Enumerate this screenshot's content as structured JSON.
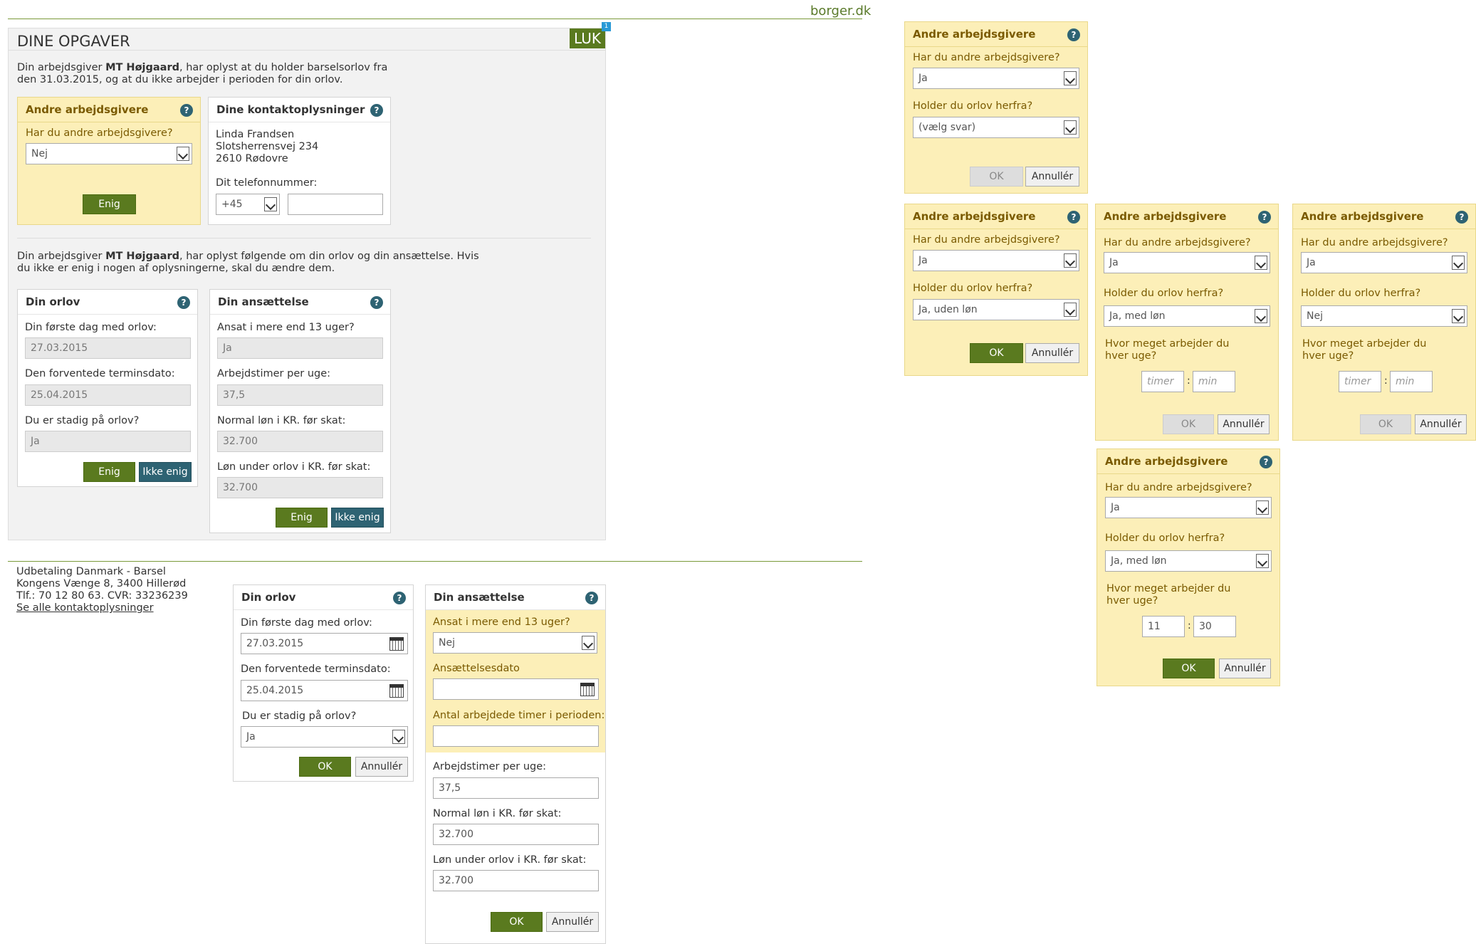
{
  "brand": "borger.dk",
  "main": {
    "title": "DINE OPGAVER",
    "close_label": "LUK",
    "badge": "1",
    "intro1_a": "Din arbejdsgiver ",
    "intro1_employer": "MT Højgaard",
    "intro1_b": ", har oplyst at du holder barselsorlov fra",
    "intro1_c": "den 31.03.2015, og at du ikke arbejder i perioden for din orlov.",
    "intro2_a": "Din arbejdsgiver ",
    "intro2_employer": "MT Højgaard",
    "intro2_b": ", har oplyst følgende om din orlov og din ansættelse. Hvis",
    "intro2_c": "du ikke er enig i nogen af oplysningerne, skal du ændre dem."
  },
  "help": "?",
  "other_employers": {
    "title": "Andre arbejdsgivere",
    "q1": "Har du andre arbejdsgivere?",
    "q2": "Holder du orlov herfra?",
    "q3": "Hvor meget arbejder du hver uge?",
    "value_no": "Nej",
    "value_yes": "Ja",
    "choose": "(vælg svar)",
    "leave_unpaid": "Ja, uden løn",
    "leave_paid": "Ja, med løn",
    "agree": "Enig",
    "hours_ph": "timer",
    "min_ph": "min",
    "hours_val": "11",
    "min_val": "30"
  },
  "contact": {
    "title": "Dine kontaktoplysninger",
    "name": "Linda Frandsen",
    "street": "Slotsherrensvej 234",
    "city": "2610 Rødovre",
    "phone_label": "Dit telefonnummer:",
    "prefix": "+45",
    "phone_value": ""
  },
  "leave": {
    "title": "Din orlov",
    "first_day_label": "Din første dag med orlov:",
    "first_day": "27.03.2015",
    "due_label": "Den forventede terminsdato:",
    "due": "25.04.2015",
    "still_label": "Du er stadig på orlov?",
    "still": "Ja"
  },
  "employment": {
    "title": "Din ansættelse",
    "over13_label": "Ansat i mere end 13 uger?",
    "over13": "Ja",
    "over13_no": "Nej",
    "hours_label": "Arbejdstimer per uge:",
    "hours": "37,5",
    "salary_label": "Normal løn i KR. før skat:",
    "salary": "32.700",
    "leave_salary_label": "Løn under orlov i KR. før skat:",
    "leave_salary": "32.700",
    "start_label": "Ansættelsesdato",
    "worked_label": "Antal arbejdede timer i perioden:"
  },
  "buttons": {
    "agree": "Enig",
    "disagree": "Ikke enig",
    "ok": "OK",
    "cancel": "Annullér"
  },
  "footer": {
    "line1": "Udbetaling Danmark - Barsel",
    "line2": "Kongens Vænge 8, 3400 Hillerød",
    "line3": "Tlf.: 70 12 80 63. CVR: 33236239",
    "link": "Se alle kontaktoplysninger"
  }
}
